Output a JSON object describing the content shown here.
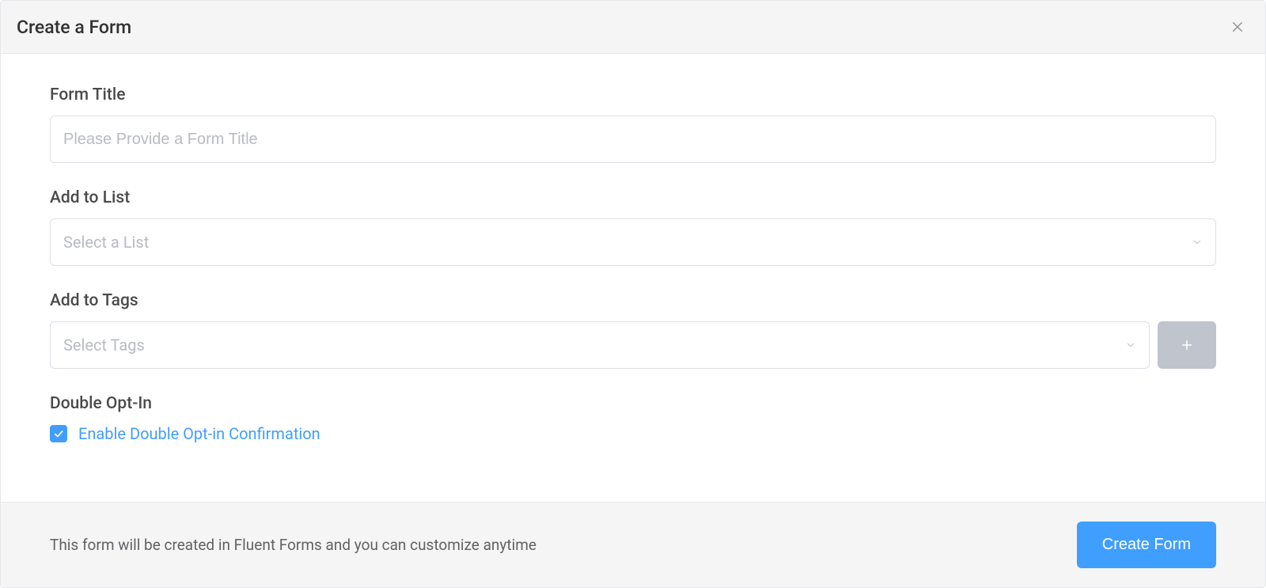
{
  "header": {
    "title": "Create a Form"
  },
  "form": {
    "title_field": {
      "label": "Form Title",
      "placeholder": "Please Provide a Form Title",
      "value": ""
    },
    "list_field": {
      "label": "Add to List",
      "placeholder": "Select a List",
      "value": ""
    },
    "tags_field": {
      "label": "Add to Tags",
      "placeholder": "Select Tags",
      "value": ""
    },
    "double_optin": {
      "label": "Double Opt-In",
      "checkbox_label": "Enable Double Opt-in Confirmation",
      "checked": true
    }
  },
  "footer": {
    "text": "This form will be created in Fluent Forms and you can customize anytime",
    "submit_label": "Create Form"
  }
}
